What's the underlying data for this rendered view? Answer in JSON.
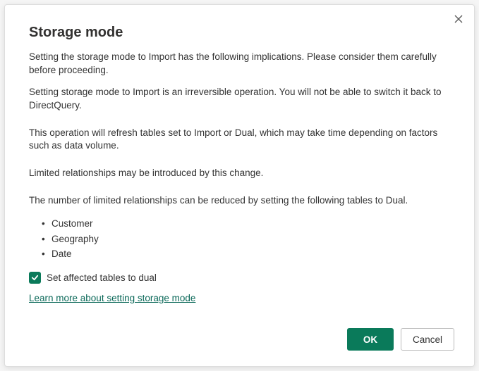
{
  "dialog": {
    "title": "Storage mode",
    "intro": "Setting the storage mode to Import has the following implications. Please consider them carefully before proceeding.",
    "irreversible": "Setting storage mode to Import is an irreversible operation.  You will not be able to switch it back to DirectQuery.",
    "refresh": "This operation will refresh tables set to Import or Dual, which may take time depending on factors such as data volume.",
    "limited": "Limited relationships may be introduced by this change.",
    "reduce": "The number of limited relationships can be reduced by setting the following tables to Dual.",
    "tables": [
      "Customer",
      "Geography",
      "Date"
    ],
    "checkbox_label": "Set affected tables to dual",
    "checkbox_checked": true,
    "learn_more": "Learn more about setting storage mode",
    "ok": "OK",
    "cancel": "Cancel"
  },
  "colors": {
    "accent": "#0a7a5a"
  }
}
